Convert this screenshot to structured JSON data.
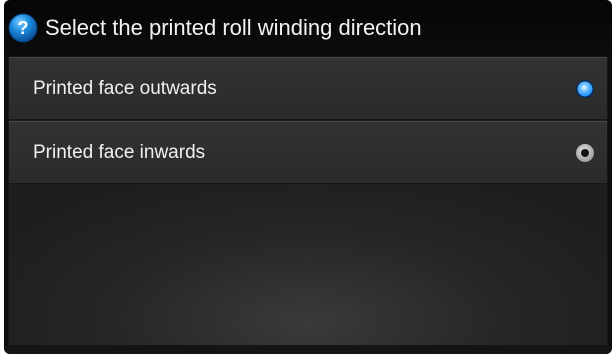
{
  "dialog": {
    "title": "Select the printed roll winding direction",
    "title_icon": "help-question-icon"
  },
  "options": [
    {
      "label": "Printed face outwards",
      "selected": true
    },
    {
      "label": "Printed face inwards",
      "selected": false
    }
  ],
  "colors": {
    "accent": "#1a8cff",
    "background": "#0d0d0d",
    "text": "#f0f0f0"
  }
}
